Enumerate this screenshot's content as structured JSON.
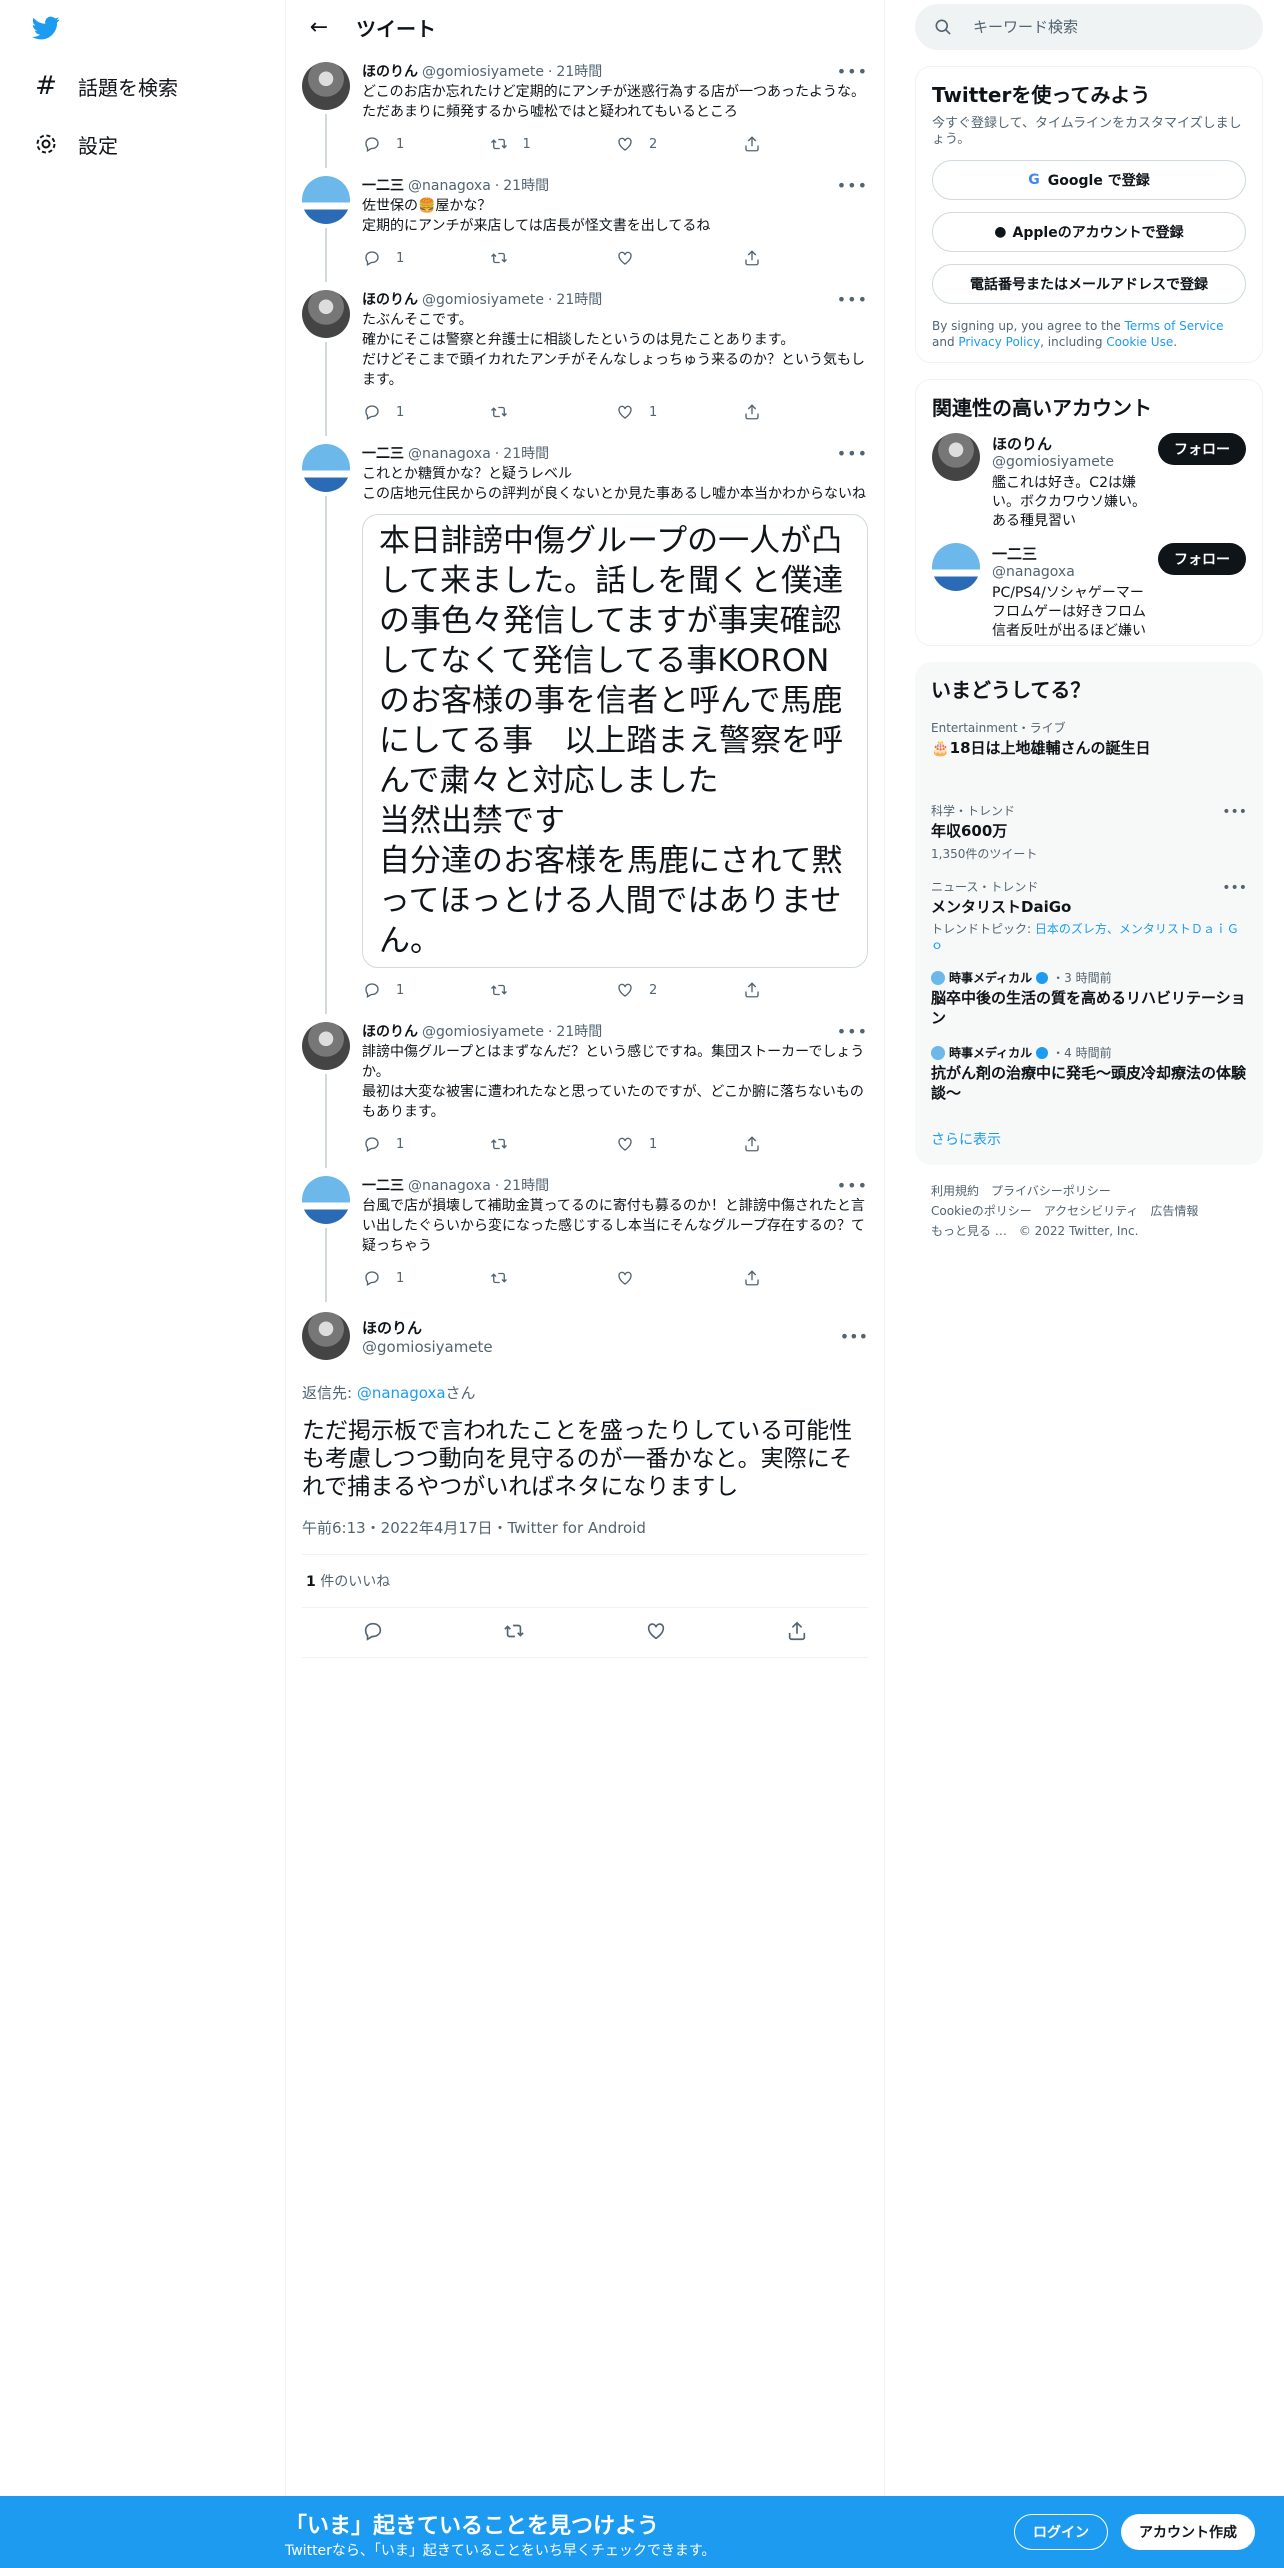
{
  "nav": {
    "items": [
      {
        "label": "話題を検索",
        "icon": "hashtag-icon"
      },
      {
        "label": "設定",
        "icon": "gear-icon"
      }
    ]
  },
  "header": {
    "title": "ツイート"
  },
  "tweets": [
    {
      "name": "ほのりん",
      "handle": "@gomiosiyamete",
      "time": "21時間",
      "text": "どこのお店か忘れたけど定期的にアンチが迷惑行為する店が一つあったような。ただあまりに頻発するから嘘松ではと疑われてもいるところ",
      "reply": "1",
      "retweet": "1",
      "like": "2"
    },
    {
      "name": "一二三",
      "handle": "@nanagoxa",
      "time": "21時間",
      "text": "佐世保の🍔屋かな？\n定期的にアンチが来店しては店長が怪文書を出してるね",
      "reply": "1",
      "retweet": "",
      "like": ""
    },
    {
      "name": "ほのりん",
      "handle": "@gomiosiyamete",
      "time": "21時間",
      "text": "たぶんそこです。\n確かにそこは警察と弁護士に相談したというのは見たことあります。\nだけどそこまで頭イカれたアンチがそんなしょっちゅう来るのか？という気もします。",
      "reply": "1",
      "retweet": "",
      "like": "1"
    },
    {
      "name": "一二三",
      "handle": "@nanagoxa",
      "time": "21時間",
      "text": "これとか糖質かな？と疑うレベル\nこの店地元住民からの評判が良くないとか見た事あるし嘘か本当かわからないね",
      "image_text": "本日誹謗中傷グループの一人が凸して来ました。話しを聞くと僕達の事色々発信してますが事実確認してなくて発信してる事KORONのお客様の事を信者と呼んで馬鹿にしてる事　以上踏まえ警察を呼んで粛々と対応しました\n当然出禁です\n自分達のお客様を馬鹿にされて黙ってほっとける人間ではありません。",
      "reply": "1",
      "retweet": "",
      "like": "2"
    },
    {
      "name": "ほのりん",
      "handle": "@gomiosiyamete",
      "time": "21時間",
      "text": "誹謗中傷グループとはまずなんだ？という感じですね。集団ストーカーでしょうか。\n最初は大変な被害に遭われたなと思っていたのですが、どこか腑に落ちないものもあります。",
      "reply": "1",
      "retweet": "",
      "like": "1"
    },
    {
      "name": "一二三",
      "handle": "@nanagoxa",
      "time": "21時間",
      "text": "台風で店が損壊して補助金貰ってるのに寄付も募るのか！と誹謗中傷されたと言い出したぐらいから変になった感じするし本当にそんなグループ存在するの？て疑っちゃう",
      "reply": "1",
      "retweet": "",
      "like": ""
    }
  ],
  "focus": {
    "name": "ほのりん",
    "handle": "@gomiosiyamete",
    "reply_prefix": "返信先: ",
    "reply_to": "@nanagoxa",
    "reply_suffix": "さん",
    "text": "ただ掲示板で言われたことを盛ったりしている可能性も考慮しつつ動向を見守るのが一番かなと。実際にそれで捕まるやつがいればネタになりますし",
    "meta": "午前6:13・2022年4月17日・Twitter for Android",
    "likes_count": "1",
    "likes_label": " 件のいいね"
  },
  "search": {
    "placeholder": "キーワード検索"
  },
  "signup": {
    "title": "Twitterを使ってみよう",
    "sub": "今すぐ登録して、タイムラインをカスタマイズしましょう。",
    "google": "Google で登録",
    "apple": "Appleのアカウントで登録",
    "phone": "電話番号またはメールアドレスで登録",
    "legal_1": "By signing up, you agree to the ",
    "tos": "Terms of Service",
    "legal_2": " and ",
    "privacy": "Privacy Policy",
    "legal_3": ", including ",
    "cookie": "Cookie Use",
    "legal_4": "."
  },
  "related": {
    "title": "関連性の高いアカウント",
    "users": [
      {
        "name": "ほのりん",
        "handle": "@gomiosiyamete",
        "bio": "艦これは好き。C2は嫌い。ボクカワウソ嫌い。ある種見習い",
        "follow": "フォロー"
      },
      {
        "name": "一二三",
        "handle": "@nanagoxa",
        "bio": "PC/PS4/ソシャゲーマー フロムゲーは好きフロム信者反吐が出るほど嫌い",
        "follow": "フォロー"
      }
    ]
  },
  "trends": {
    "title": "いまどうしてる？",
    "items": [
      {
        "cat": "Entertainment・ライブ",
        "title": "🎂18日は上地雄輔さんの誕生日"
      },
      {
        "cat": "科学・トレンド",
        "title": "年収600万",
        "count": "1,350件のツイート"
      },
      {
        "cat": "ニュース・トレンド",
        "title": "メンタリストDaiGo",
        "topic_prefix": "トレンドトピック: ",
        "topic": "日本のズレ方、メンタリストＤａｉＧｏ"
      },
      {
        "src": "時事メディカル",
        "time": "・3 時間前",
        "title": "脳卒中後の生活の質を高めるリハビリテーション"
      },
      {
        "src": "時事メディカル",
        "time": "・4 時間前",
        "title": "抗がん剤の治療中に発毛～頭皮冷却療法の体験談～"
      }
    ],
    "more": "さらに表示"
  },
  "footer": {
    "links": [
      "利用規約",
      "プライバシーポリシー",
      "Cookieのポリシー",
      "アクセシビリティ",
      "広告情報",
      "もっと見る …"
    ],
    "copyright": "© 2022 Twitter, Inc."
  },
  "bottombar": {
    "title": "「いま」起きていることを見つけよう",
    "sub": "Twitterなら、「いま」起きていることをいち早くチェックできます。",
    "login": "ログイン",
    "signup": "アカウント作成"
  },
  "colors": {
    "accent": "#1d9bf0",
    "text": "#0f1419",
    "muted": "#536471"
  }
}
